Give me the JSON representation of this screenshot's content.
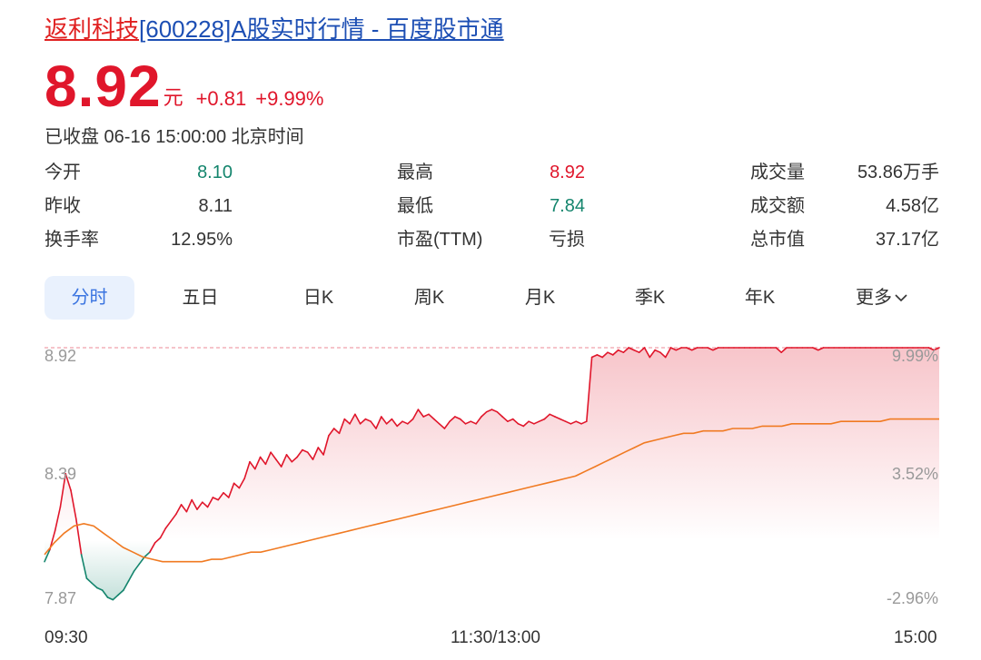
{
  "header": {
    "name": "返利科技",
    "title_rest": "[600228]A股实时行情 - 百度股市通"
  },
  "quote": {
    "price": "8.92",
    "unit": "元",
    "change": "+0.81",
    "change_pct": "+9.99%",
    "status": "已收盘 06-16 15:00:00 北京时间"
  },
  "stats": [
    {
      "label": "今开",
      "value": "8.10",
      "color": "green"
    },
    {
      "label": "最高",
      "value": "8.92",
      "color": "red"
    },
    {
      "label": "成交量",
      "value": "53.86万手",
      "color": "dark"
    },
    {
      "label": "昨收",
      "value": "8.11",
      "color": "dark"
    },
    {
      "label": "最低",
      "value": "7.84",
      "color": "green"
    },
    {
      "label": "成交额",
      "value": "4.58亿",
      "color": "dark"
    },
    {
      "label": "换手率",
      "value": "12.95%",
      "color": "dark"
    },
    {
      "label": "市盈(TTM)",
      "value": "亏损",
      "color": "dark"
    },
    {
      "label": "总市值",
      "value": "37.17亿",
      "color": "dark"
    }
  ],
  "tabs": [
    {
      "label": "分时",
      "active": true
    },
    {
      "label": "五日"
    },
    {
      "label": "日K"
    },
    {
      "label": "周K"
    },
    {
      "label": "月K"
    },
    {
      "label": "季K"
    },
    {
      "label": "年K"
    },
    {
      "label": "更多"
    }
  ],
  "tab_more_icon": "chevron-down-icon",
  "colors": {
    "up": "#e0162b",
    "down": "#14856d",
    "avg_line": "#f07a22",
    "tab_active_bg": "#e9f1fd",
    "tab_active_text": "#3a74e0"
  },
  "chart_data": {
    "type": "line",
    "series": [
      {
        "name": "price",
        "values": [
          8.02,
          8.07,
          8.15,
          8.25,
          8.39,
          8.32,
          8.2,
          8.05,
          7.95,
          7.93,
          7.91,
          7.9,
          7.87,
          7.86,
          7.88,
          7.9,
          7.94,
          7.98,
          8.01,
          8.04,
          8.06,
          8.1,
          8.12,
          8.16,
          8.19,
          8.22,
          8.26,
          8.23,
          8.28,
          8.24,
          8.27,
          8.25,
          8.29,
          8.28,
          8.31,
          8.29,
          8.35,
          8.33,
          8.37,
          8.44,
          8.41,
          8.46,
          8.43,
          8.48,
          8.45,
          8.42,
          8.47,
          8.44,
          8.46,
          8.49,
          8.48,
          8.45,
          8.5,
          8.47,
          8.55,
          8.58,
          8.56,
          8.62,
          8.6,
          8.64,
          8.6,
          8.62,
          8.61,
          8.58,
          8.63,
          8.6,
          8.62,
          8.59,
          8.61,
          8.6,
          8.62,
          8.66,
          8.63,
          8.64,
          8.62,
          8.6,
          8.58,
          8.61,
          8.63,
          8.62,
          8.6,
          8.61,
          8.6,
          8.63,
          8.65,
          8.66,
          8.65,
          8.63,
          8.61,
          8.62,
          8.6,
          8.59,
          8.61,
          8.6,
          8.61,
          8.62,
          8.64,
          8.63,
          8.62,
          8.61,
          8.6,
          8.61,
          8.6,
          8.61,
          8.88,
          8.89,
          8.88,
          8.9,
          8.89,
          8.91,
          8.9,
          8.92,
          8.91,
          8.9,
          8.92,
          8.88,
          8.91,
          8.9,
          8.88,
          8.92,
          8.91,
          8.92,
          8.92,
          8.91,
          8.92,
          8.92,
          8.92,
          8.91,
          8.92,
          8.92,
          8.92,
          8.92,
          8.92,
          8.92,
          8.92,
          8.92,
          8.92,
          8.92,
          8.92,
          8.92,
          8.9,
          8.92,
          8.92,
          8.92,
          8.92,
          8.92,
          8.92,
          8.91,
          8.92,
          8.92,
          8.92,
          8.92,
          8.92,
          8.92,
          8.92,
          8.92,
          8.92,
          8.92,
          8.92,
          8.92,
          8.92,
          8.92,
          8.92,
          8.92,
          8.92,
          8.92,
          8.92,
          8.92,
          8.92,
          8.91,
          8.92
        ]
      },
      {
        "name": "avg",
        "values": [
          8.05,
          8.1,
          8.14,
          8.17,
          8.18,
          8.17,
          8.14,
          8.11,
          8.08,
          8.06,
          8.04,
          8.03,
          8.02,
          8.02,
          8.02,
          8.02,
          8.02,
          8.03,
          8.03,
          8.04,
          8.05,
          8.06,
          8.06,
          8.07,
          8.08,
          8.09,
          8.1,
          8.11,
          8.12,
          8.13,
          8.14,
          8.15,
          8.16,
          8.17,
          8.18,
          8.19,
          8.2,
          8.21,
          8.22,
          8.23,
          8.24,
          8.25,
          8.26,
          8.27,
          8.28,
          8.29,
          8.3,
          8.31,
          8.32,
          8.33,
          8.34,
          8.35,
          8.36,
          8.37,
          8.38,
          8.4,
          8.42,
          8.44,
          8.46,
          8.48,
          8.5,
          8.52,
          8.53,
          8.54,
          8.55,
          8.56,
          8.56,
          8.57,
          8.57,
          8.57,
          8.58,
          8.58,
          8.58,
          8.59,
          8.59,
          8.59,
          8.6,
          8.6,
          8.6,
          8.6,
          8.6,
          8.61,
          8.61,
          8.61,
          8.61,
          8.61,
          8.62,
          8.62,
          8.62,
          8.62,
          8.62,
          8.62
        ]
      }
    ],
    "ylim": [
      7.87,
      8.92
    ],
    "y_ticks_left": [
      "8.92",
      "8.39",
      "7.87"
    ],
    "y_ticks_right": [
      "9.99%",
      "3.52%",
      "-2.96%"
    ],
    "x_ticks": [
      "09:30",
      "11:30/13:00",
      "15:00"
    ],
    "prev_close": 8.11
  }
}
